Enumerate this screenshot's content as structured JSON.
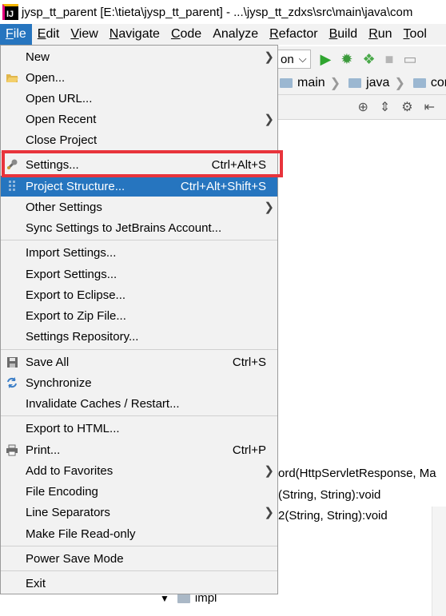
{
  "window": {
    "title": "jysp_tt_parent [E:\\tieta\\jysp_tt_parent] - ...\\jysp_tt_zdxs\\src\\main\\java\\com"
  },
  "menubar": [
    {
      "label": "File",
      "mnemonic": "F",
      "rest": "ile",
      "active": true
    },
    {
      "label": "Edit",
      "mnemonic": "E",
      "rest": "dit"
    },
    {
      "label": "View",
      "mnemonic": "V",
      "rest": "iew"
    },
    {
      "label": "Navigate",
      "mnemonic": "N",
      "rest": "avigate"
    },
    {
      "label": "Code",
      "mnemonic": "C",
      "rest": "ode"
    },
    {
      "label": "Analyze",
      "mnemonic": "",
      "rest": "Analyze"
    },
    {
      "label": "Refactor",
      "mnemonic": "R",
      "rest": "efactor"
    },
    {
      "label": "Build",
      "mnemonic": "B",
      "rest": "uild"
    },
    {
      "label": "Run",
      "mnemonic": "R",
      "rest": "un"
    },
    {
      "label": "Tool",
      "mnemonic": "T",
      "rest": "ool"
    }
  ],
  "toolbar": {
    "config_partial": "on",
    "dropdown_glyph": "⌵"
  },
  "navbar": {
    "crumbs": [
      "main",
      "java",
      "com"
    ]
  },
  "code": {
    "line1": "ord(HttpServletResponse, Ma",
    "line2": "(String, String):void",
    "line3": "2(String, String):void"
  },
  "tree": {
    "folder_label": "impl"
  },
  "file_menu": {
    "items": [
      {
        "label": "New",
        "arrow": true
      },
      {
        "label": "Open...",
        "icon": "folder-open-icon"
      },
      {
        "label": "Open URL..."
      },
      {
        "label": "Open Recent",
        "arrow": true
      },
      {
        "label": "Close Project"
      },
      {
        "label": "Settings...",
        "shortcut": "Ctrl+Alt+S",
        "icon": "wrench-icon"
      },
      {
        "label": "Project Structure...",
        "shortcut": "Ctrl+Alt+Shift+S",
        "icon": "project-structure-icon",
        "selected": true
      },
      {
        "label": "Other Settings",
        "arrow": true
      },
      {
        "label": "Sync Settings to JetBrains Account..."
      },
      {
        "label": "Import Settings..."
      },
      {
        "label": "Export Settings..."
      },
      {
        "label": "Export to Eclipse..."
      },
      {
        "label": "Export to Zip File..."
      },
      {
        "label": "Settings Repository..."
      },
      {
        "label": "Save All",
        "shortcut": "Ctrl+S",
        "icon": "save-icon"
      },
      {
        "label": "Synchronize",
        "icon": "sync-icon"
      },
      {
        "label": "Invalidate Caches / Restart..."
      },
      {
        "label": "Export to HTML..."
      },
      {
        "label": "Print...",
        "shortcut": "Ctrl+P",
        "icon": "print-icon"
      },
      {
        "label": "Add to Favorites",
        "arrow": true
      },
      {
        "label": "File Encoding"
      },
      {
        "label": "Line Separators",
        "arrow": true
      },
      {
        "label": "Make File Read-only"
      },
      {
        "label": "Power Save Mode"
      },
      {
        "label": "Exit"
      }
    ]
  },
  "colors": {
    "selection": "#2675bf",
    "highlight_box": "#e8343c",
    "menu_bg": "#f2f2f2"
  }
}
